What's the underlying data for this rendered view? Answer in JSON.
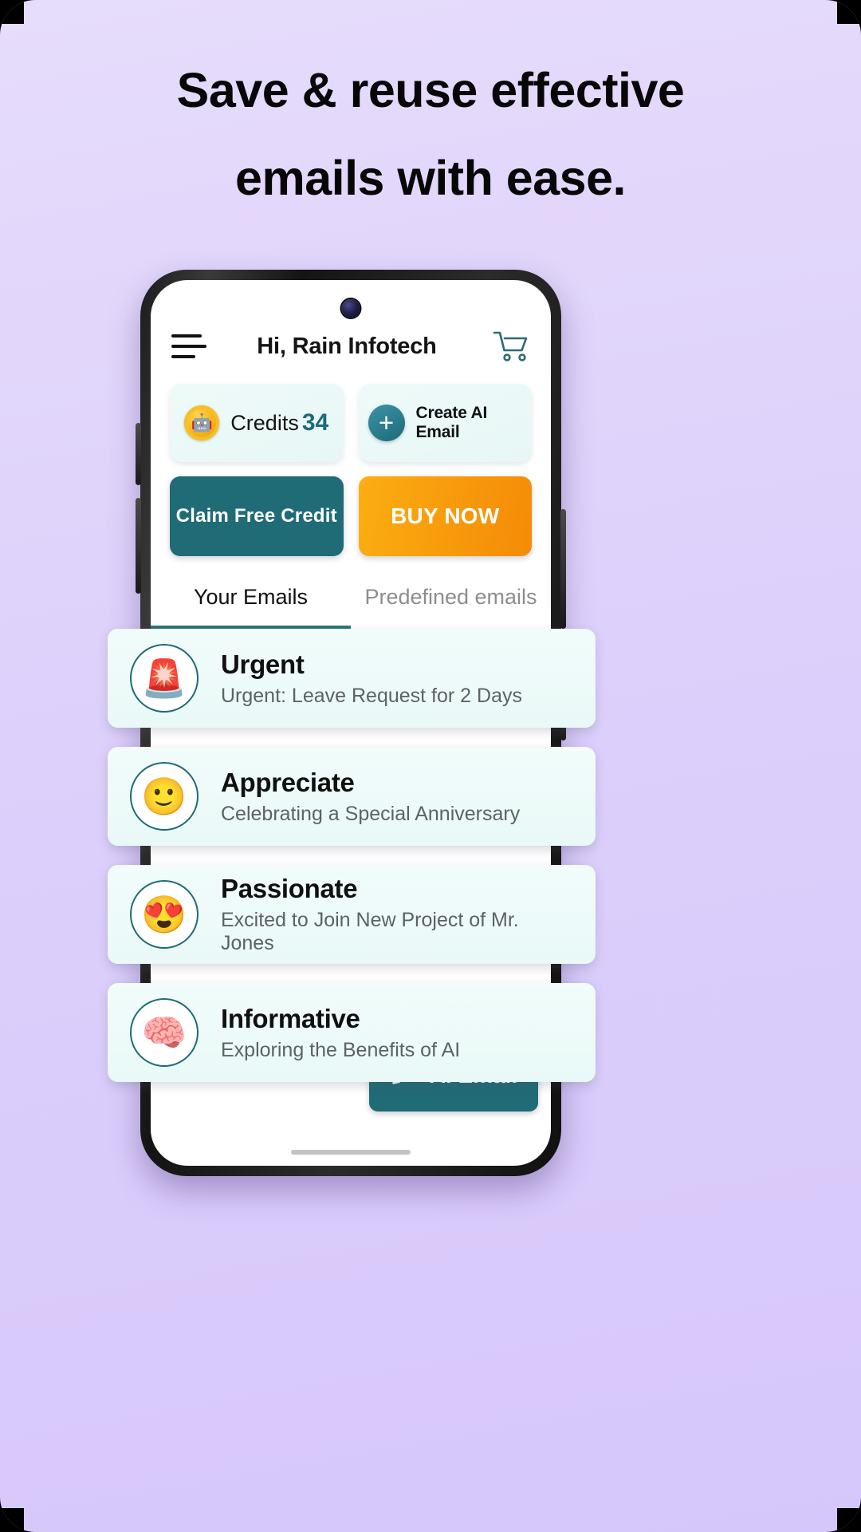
{
  "headline": {
    "line1": "Save & reuse effective",
    "line2": "emails with ease."
  },
  "colors": {
    "background_top": "#e6dcfb",
    "teal": "#1f6b76",
    "orange": "#f79a0b",
    "card_mint": "#eefaf9",
    "credits_number": "#1d6a79"
  },
  "app": {
    "header": {
      "menu_icon": "hamburger-icon",
      "title": "Hi, Rain Infotech",
      "cart_icon": "shopping-cart-icon"
    },
    "credits_card": {
      "icon": "coin-robot-icon",
      "label": "Credits",
      "value": "34"
    },
    "create_card": {
      "icon": "plus-icon",
      "label": "Create AI Email"
    },
    "buttons": {
      "claim": "Claim Free Credit",
      "buy": "BUY NOW"
    },
    "tabs": [
      {
        "label": "Your Emails",
        "active": true
      },
      {
        "label": "Predefined emails",
        "active": false
      }
    ],
    "emails": [
      {
        "icon": "siren-icon",
        "glyph": "🚨",
        "title": "Urgent",
        "subject": "Urgent: Leave Request for 2 Days"
      },
      {
        "icon": "smiley-icon",
        "glyph": "🙂",
        "title": "Appreciate",
        "subject": "Celebrating a Special Anniversary"
      },
      {
        "icon": "heart-eyes-icon",
        "glyph": "😍",
        "title": "Passionate",
        "subject": "Excited to Join New Project of Mr. Jones"
      },
      {
        "icon": "brain-icon",
        "glyph": "🧠",
        "title": "Informative",
        "subject": "Exploring the Benefits of AI"
      }
    ],
    "ai_button": {
      "icon": "pencil-icon",
      "label": "AI Email"
    }
  }
}
